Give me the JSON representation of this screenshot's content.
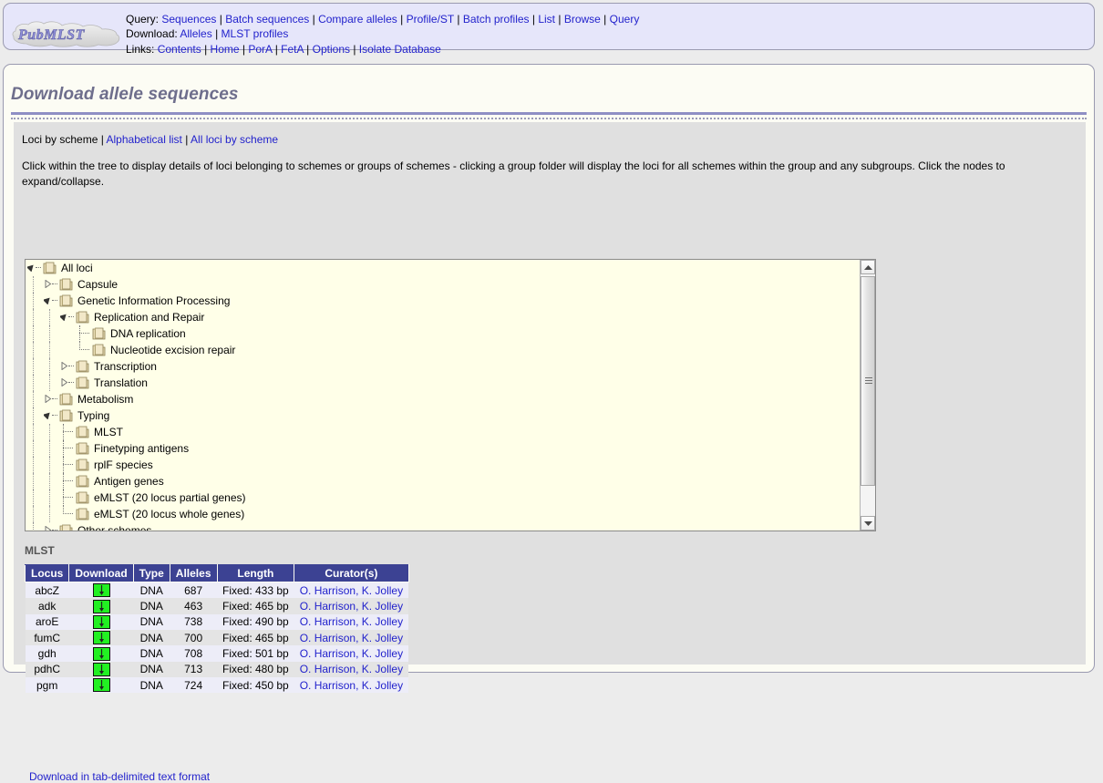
{
  "site": {
    "logo_text": "PubMLST"
  },
  "header": {
    "rows": [
      {
        "label": "Query:",
        "links": [
          "Sequences",
          "Batch sequences",
          "Compare alleles",
          "Profile/ST",
          "Batch profiles",
          "List",
          "Browse",
          "Query"
        ]
      },
      {
        "label": "Download:",
        "links": [
          "Alleles",
          "MLST profiles"
        ]
      },
      {
        "label": "Links:",
        "links": [
          "Contents",
          "Home",
          "PorA",
          "FetA",
          "Options",
          "Isolate Database"
        ]
      }
    ]
  },
  "page": {
    "title": "Download allele sequences"
  },
  "tabbar": {
    "current": "Loci by scheme",
    "links": [
      "Alphabetical list",
      "All loci by scheme"
    ]
  },
  "instructions": {
    "text": "Click within the tree to display details of loci belonging to schemes or groups of schemes - clicking a group folder will display the loci for all schemes within the group and any subgroups. Click the nodes to expand/collapse."
  },
  "tree": {
    "nodes": [
      {
        "label": "All loci",
        "depth": 0,
        "state": "expanded"
      },
      {
        "label": "Capsule",
        "depth": 1,
        "state": "collapsed"
      },
      {
        "label": "Genetic Information Processing",
        "depth": 1,
        "state": "expanded"
      },
      {
        "label": "Replication and Repair",
        "depth": 2,
        "state": "expanded"
      },
      {
        "label": "DNA replication",
        "depth": 3,
        "state": "leaf"
      },
      {
        "label": "Nucleotide excision repair",
        "depth": 3,
        "state": "leaf-last"
      },
      {
        "label": "Transcription",
        "depth": 2,
        "state": "collapsed"
      },
      {
        "label": "Translation",
        "depth": 2,
        "state": "collapsed"
      },
      {
        "label": "Metabolism",
        "depth": 1,
        "state": "collapsed"
      },
      {
        "label": "Typing",
        "depth": 1,
        "state": "expanded"
      },
      {
        "label": "MLST",
        "depth": 2,
        "state": "leaf"
      },
      {
        "label": "Finetyping antigens",
        "depth": 2,
        "state": "leaf"
      },
      {
        "label": "rplF species",
        "depth": 2,
        "state": "leaf"
      },
      {
        "label": "Antigen genes",
        "depth": 2,
        "state": "leaf"
      },
      {
        "label": "eMLST (20 locus partial genes)",
        "depth": 2,
        "state": "leaf"
      },
      {
        "label": "eMLST (20 locus whole genes)",
        "depth": 2,
        "state": "leaf-last"
      },
      {
        "label": "Other schemes",
        "depth": 1,
        "state": "collapsed"
      }
    ]
  },
  "scheme": {
    "name": "MLST"
  },
  "table": {
    "columns": [
      "Locus",
      "Download",
      "Type",
      "Alleles",
      "Length",
      "Curator(s)"
    ],
    "rows": [
      {
        "locus": "abcZ",
        "download": "download-icon",
        "type": "DNA",
        "alleles": "687",
        "length": "Fixed: 433 bp",
        "curators": "O. Harrison, K. Jolley"
      },
      {
        "locus": "adk",
        "download": "download-icon",
        "type": "DNA",
        "alleles": "463",
        "length": "Fixed: 465 bp",
        "curators": "O. Harrison, K. Jolley"
      },
      {
        "locus": "aroE",
        "download": "download-icon",
        "type": "DNA",
        "alleles": "738",
        "length": "Fixed: 490 bp",
        "curators": "O. Harrison, K. Jolley"
      },
      {
        "locus": "fumC",
        "download": "download-icon",
        "type": "DNA",
        "alleles": "700",
        "length": "Fixed: 465 bp",
        "curators": "O. Harrison, K. Jolley"
      },
      {
        "locus": "gdh",
        "download": "download-icon",
        "type": "DNA",
        "alleles": "708",
        "length": "Fixed: 501 bp",
        "curators": "O. Harrison, K. Jolley"
      },
      {
        "locus": "pdhC",
        "download": "download-icon",
        "type": "DNA",
        "alleles": "713",
        "length": "Fixed: 480 bp",
        "curators": "O. Harrison, K. Jolley"
      },
      {
        "locus": "pgm",
        "download": "download-icon",
        "type": "DNA",
        "alleles": "724",
        "length": "Fixed: 450 bp",
        "curators": "O. Harrison, K. Jolley"
      }
    ]
  },
  "footer": {
    "tab_download_link": "Download in tab-delimited text format"
  },
  "colors": {
    "header_bg": "#e6e6fa",
    "panel_bg": "#fcfcf4",
    "content_bg": "#e0e0e0",
    "tree_bg": "#ffffe8",
    "table_header_bg": "#3c4293",
    "link": "#2222cc",
    "title": "#6e6e8c",
    "download_button": "#22f022"
  }
}
